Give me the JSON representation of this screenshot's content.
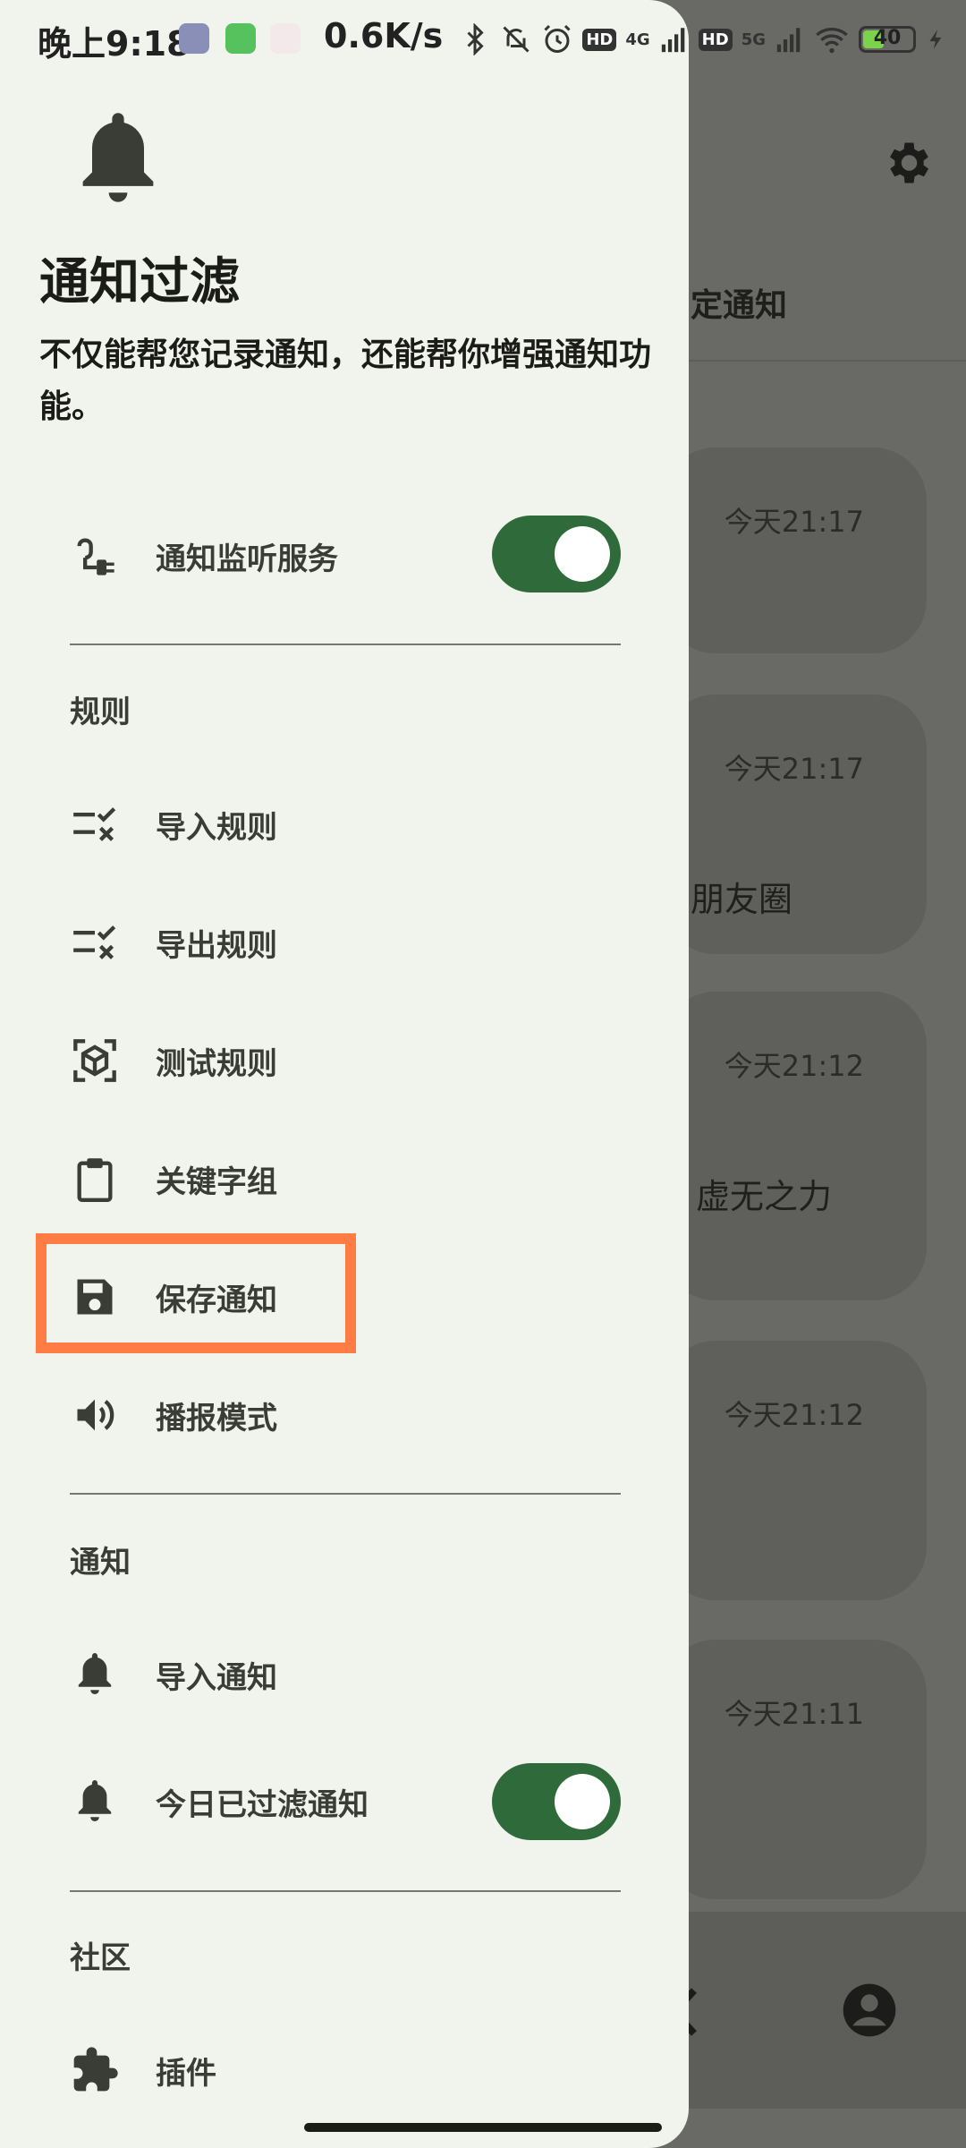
{
  "status_bar": {
    "time": "晚上9:18",
    "net_speed": "0.6K/s",
    "network_1": "4G",
    "network_2": "5G",
    "hd_label": "HD",
    "battery": "40"
  },
  "drawer": {
    "title": "通知过滤",
    "subtitle": "不仅能帮您记录通知，还能帮你增强通知功能。",
    "service_row": {
      "label": "通知监听服务",
      "icon": "power-plug-icon",
      "toggle_on": true
    },
    "sections": {
      "rules": "规则",
      "notifications": "通知",
      "community": "社区"
    },
    "rules_items": [
      {
        "label": "导入规则",
        "icon": "checklist-icon"
      },
      {
        "label": "导出规则",
        "icon": "checklist-icon"
      },
      {
        "label": "测试规则",
        "icon": "cube-scan-icon"
      },
      {
        "label": "关键字组",
        "icon": "clipboard-icon"
      },
      {
        "label": "保存通知",
        "icon": "floppy-disk-icon"
      },
      {
        "label": "播报模式",
        "icon": "speaker-icon"
      }
    ],
    "notif_items": [
      {
        "label": "导入通知",
        "icon": "bell-icon"
      },
      {
        "label": "今日已过滤通知",
        "icon": "bell-icon",
        "toggle_on": true
      }
    ],
    "community_items": [
      {
        "label": "插件",
        "icon": "puzzle-icon"
      }
    ]
  },
  "background": {
    "tab_label": "定通知",
    "cards": [
      {
        "time": "今天21:17",
        "text": ""
      },
      {
        "time": "今天21:17",
        "text": "朋友圈"
      },
      {
        "time": "今天21:12",
        "text": "，虚无之力"
      },
      {
        "time": "今天21:12",
        "text": ""
      },
      {
        "time": "今天21:11",
        "text": ""
      }
    ]
  },
  "colors": {
    "accent": "#2e6a3a",
    "highlight": "#ff7c44",
    "drawer_bg": "#f1f4ec"
  }
}
